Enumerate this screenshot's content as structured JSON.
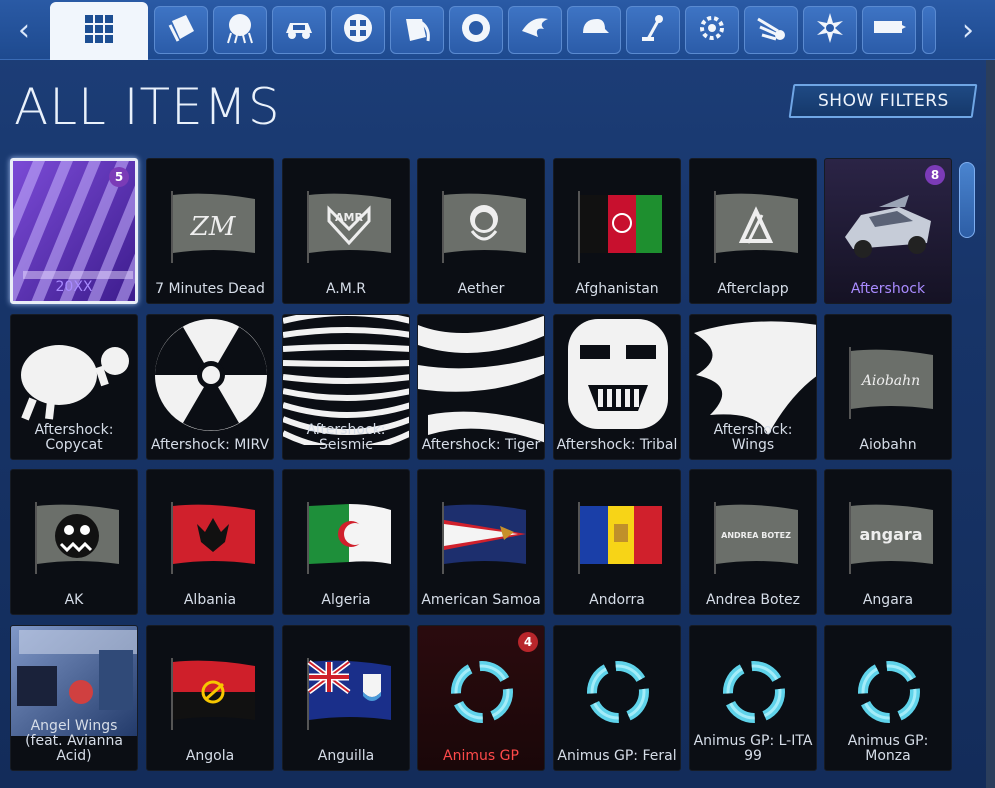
{
  "nav": {
    "prev_arrow": "‹",
    "next_arrow": "›",
    "tabs": [
      {
        "icon": "grid-icon",
        "active": true
      },
      {
        "icon": "decal-icon"
      },
      {
        "icon": "goal-explosion-icon"
      },
      {
        "icon": "car-body-icon"
      },
      {
        "icon": "wheels-icon"
      },
      {
        "icon": "paint-can-icon"
      },
      {
        "icon": "tire-icon"
      },
      {
        "icon": "boost-icon"
      },
      {
        "icon": "cap-topper-icon"
      },
      {
        "icon": "antenna-icon"
      },
      {
        "icon": "engine-audio-icon"
      },
      {
        "icon": "trail-icon"
      },
      {
        "icon": "banner-burst-icon"
      },
      {
        "icon": "banner-icon"
      },
      {
        "icon": "more-icon"
      }
    ]
  },
  "header": {
    "title": "ALL ITEMS",
    "filters_button": "SHOW FILTERS"
  },
  "colors": {
    "accent": "#6fa6e5",
    "premium_text": "#a98bff",
    "exotic_text": "#ff4a4a",
    "badge_purple": "#7b3bb7",
    "badge_red": "#b8262b"
  },
  "items": [
    {
      "label": "20XX",
      "art": "20xx",
      "rarity": "premium",
      "badge": "5",
      "selected": true
    },
    {
      "label": "7 Minutes Dead",
      "art": "flag-7md"
    },
    {
      "label": "A.M.R",
      "art": "flag-amr"
    },
    {
      "label": "Aether",
      "art": "flag-aether"
    },
    {
      "label": "Afghanistan",
      "art": "flag-afghanistan"
    },
    {
      "label": "Afterclapp",
      "art": "flag-afterclapp"
    },
    {
      "label": "Aftershock",
      "art": "car-aftershock",
      "rarity": "premium",
      "badge": "8"
    },
    {
      "label": "Aftershock: Copycat",
      "art": "cat"
    },
    {
      "label": "Aftershock: MIRV",
      "art": "radiation"
    },
    {
      "label": "Aftershock: Seismic",
      "art": "seismic"
    },
    {
      "label": "Aftershock: Tiger",
      "art": "tiger"
    },
    {
      "label": "Aftershock: Tribal",
      "art": "tribal"
    },
    {
      "label": "Aftershock: Wings",
      "art": "wings"
    },
    {
      "label": "Aiobahn",
      "art": "flag-aiobahn",
      "flag_text": "Aiobahn"
    },
    {
      "label": "AK",
      "art": "flag-ak"
    },
    {
      "label": "Albania",
      "art": "flag-albania"
    },
    {
      "label": "Algeria",
      "art": "flag-algeria"
    },
    {
      "label": "American Samoa",
      "art": "flag-samoa"
    },
    {
      "label": "Andorra",
      "art": "flag-andorra"
    },
    {
      "label": "Andrea Botez",
      "art": "flag-text",
      "flag_text": "ANDREA BOTEZ"
    },
    {
      "label": "Angara",
      "art": "flag-text-big",
      "flag_text": "angara"
    },
    {
      "label": "Angel Wings (feat. Avianna Acid)",
      "art": "album"
    },
    {
      "label": "Angola",
      "art": "flag-angola"
    },
    {
      "label": "Anguilla",
      "art": "flag-anguilla"
    },
    {
      "label": "Animus GP",
      "art": "wheel",
      "rarity": "exotic",
      "badge": "4"
    },
    {
      "label": "Animus GP: Feral",
      "art": "wheel"
    },
    {
      "label": "Animus GP: L-ITA 99",
      "art": "wheel"
    },
    {
      "label": "Animus GP: Monza",
      "art": "wheel"
    }
  ]
}
